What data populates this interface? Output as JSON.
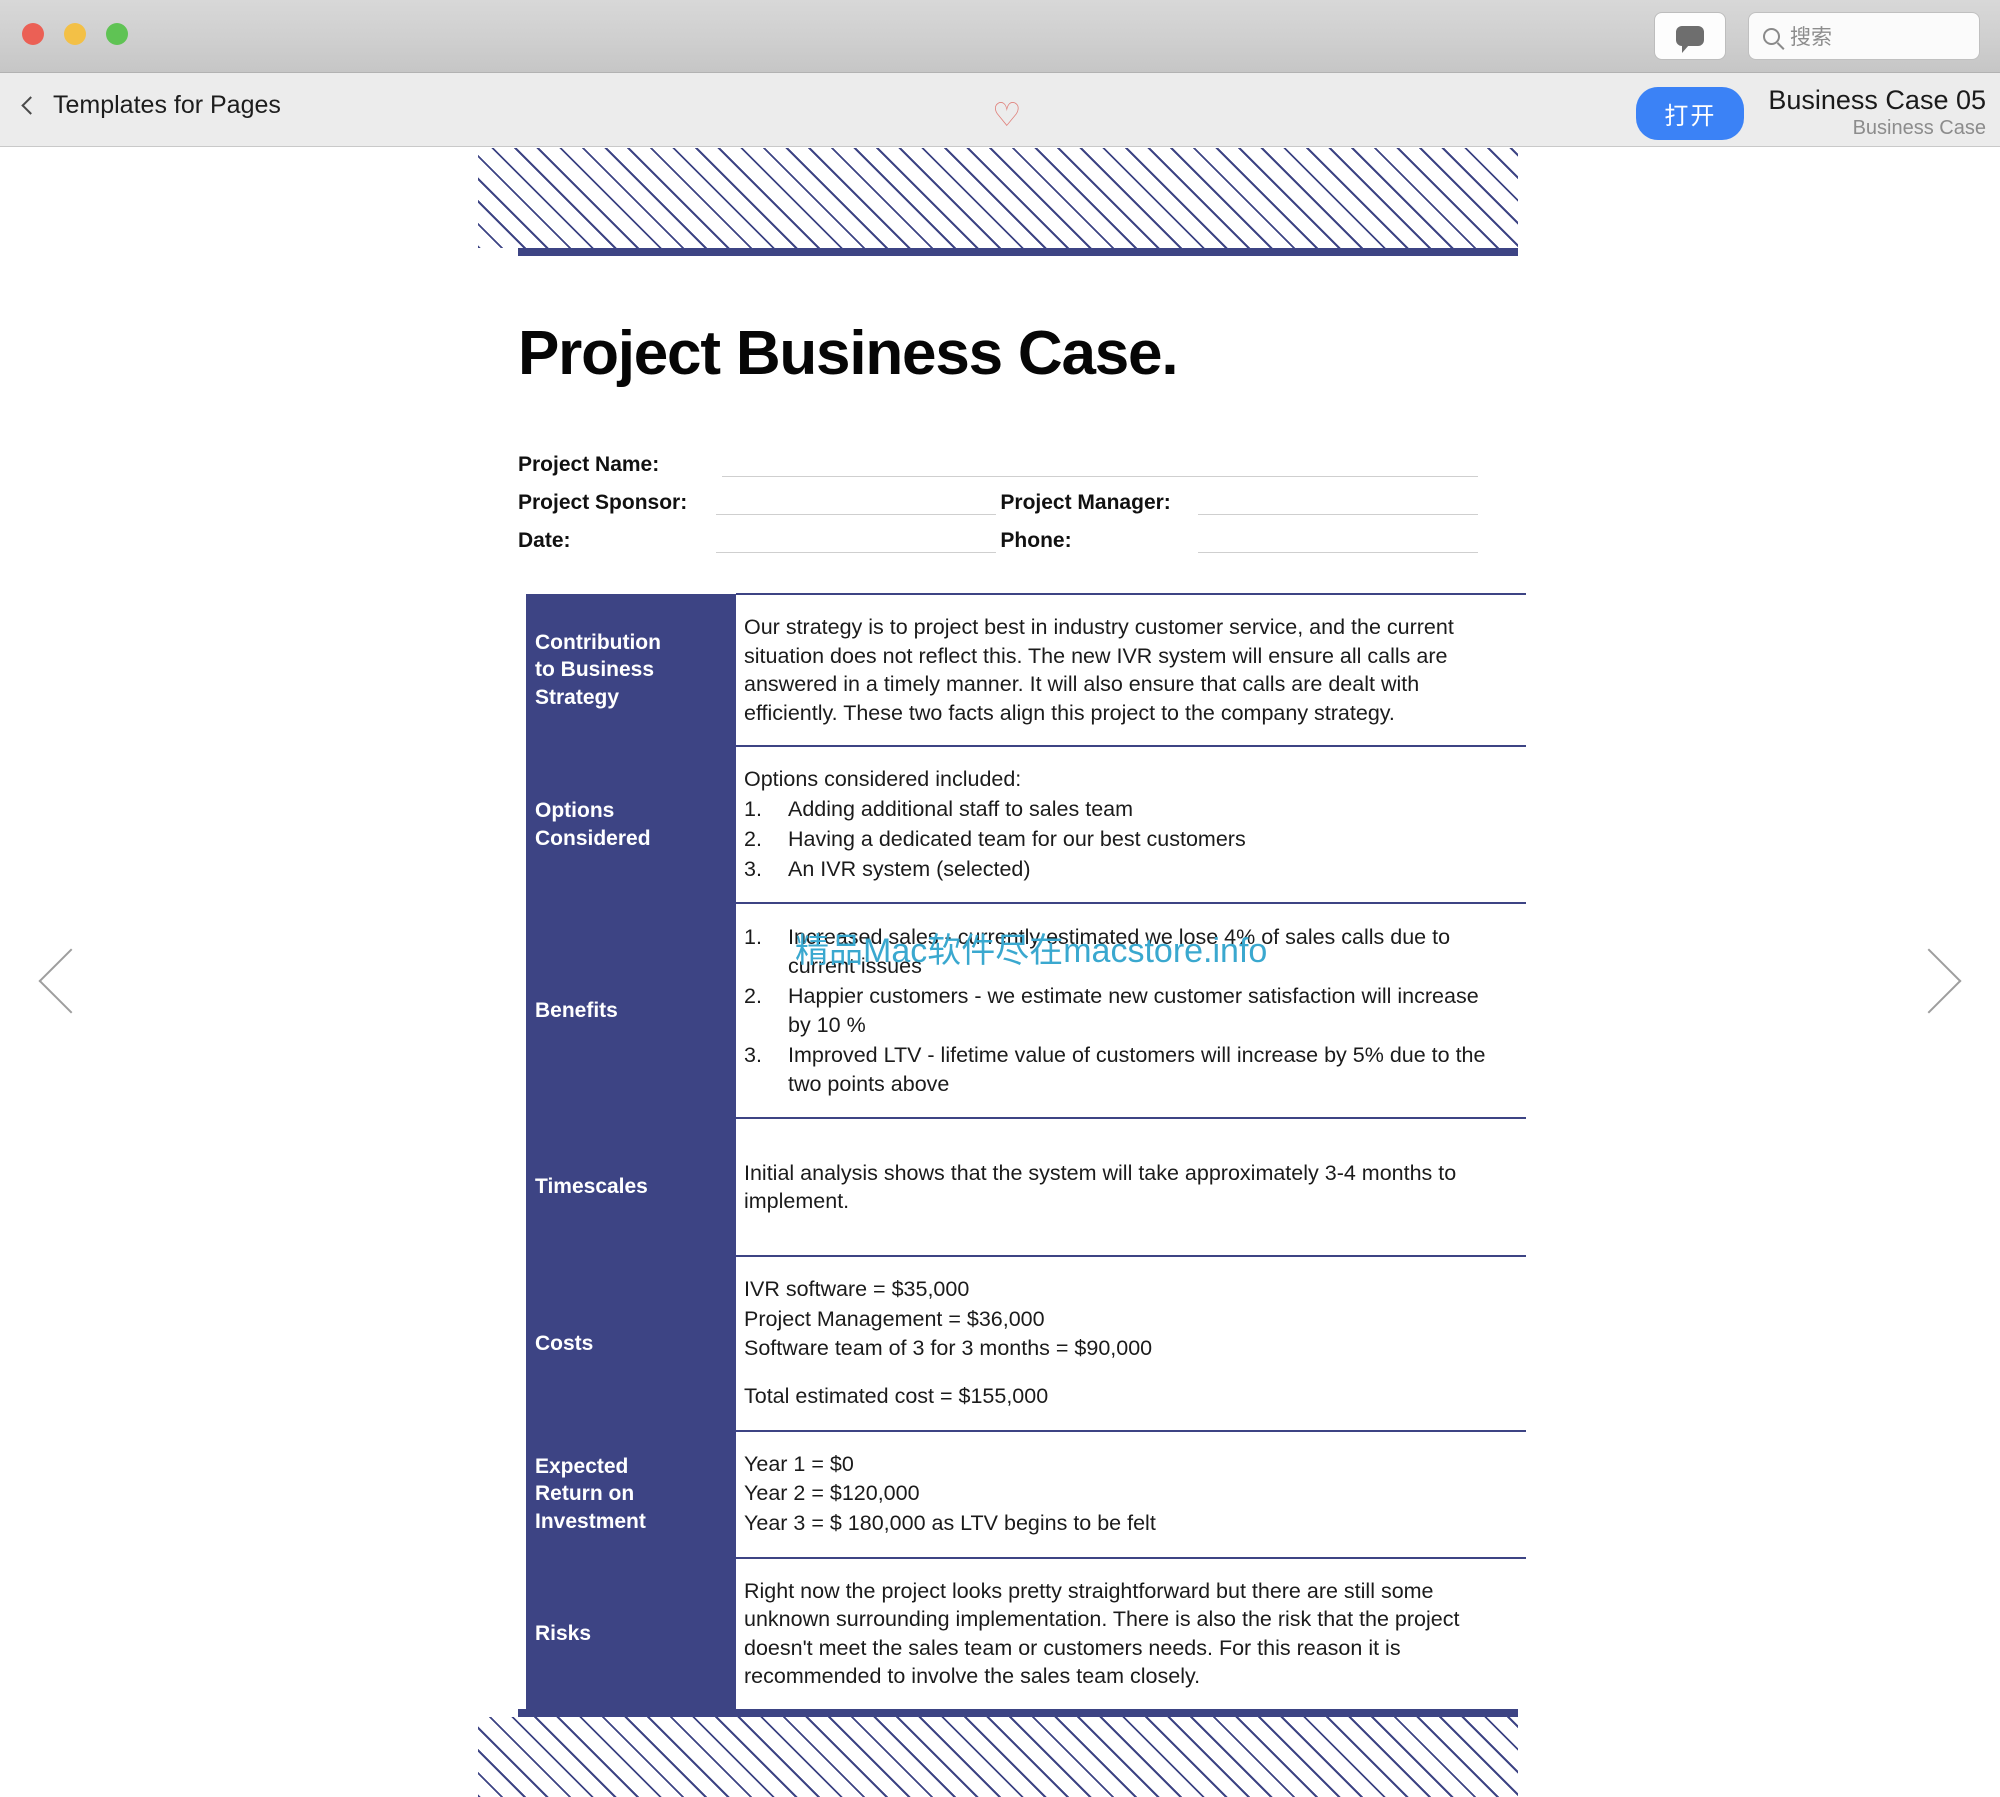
{
  "window": {
    "traffic_lights": [
      "close",
      "minimize",
      "zoom"
    ],
    "comment_icon": "comment-bubble-icon",
    "search": {
      "placeholder": "搜索",
      "value": "",
      "icon": "search-icon"
    }
  },
  "toolbar": {
    "back_label": "Templates for Pages",
    "back_icon": "chevron-left-icon",
    "favorite_icon": "heart-outline-icon",
    "open_button": "打开",
    "doc_title": "Business Case 05",
    "doc_subtitle": "Business Case"
  },
  "navigation": {
    "prev_icon": "chevron-left-icon",
    "next_icon": "chevron-right-icon"
  },
  "document": {
    "heading": "Project Business Case.",
    "form_fields": [
      {
        "label": "Project Name:",
        "value": ""
      },
      {
        "label": "Project Sponsor:",
        "value": ""
      },
      {
        "label": "Project Manager:",
        "value": ""
      },
      {
        "label": "Date:",
        "value": ""
      },
      {
        "label": "Phone:",
        "value": ""
      }
    ],
    "sections": [
      {
        "title": "Contribution\nto Business\nStrategy",
        "paragraph": "Our strategy is to project best in industry customer service, and the current situation does not reflect this. The new IVR system will ensure all calls are answered in a timely manner. It will also ensure that calls are dealt with efficiently. These two facts align this project to the company strategy."
      },
      {
        "title": "Options\nConsidered",
        "intro": "Options considered included:",
        "items": [
          "Adding additional staff to sales team",
          "Having a dedicated team for our best customers",
          "An IVR system (selected)"
        ]
      },
      {
        "title": "Benefits",
        "items": [
          "Increased sales - currently estimated we lose 4% of sales calls due to current issues",
          "Happier customers - we estimate new customer satisfaction will increase by 10 %",
          "Improved LTV - lifetime value of customers will increase by 5% due to the two points above"
        ]
      },
      {
        "title": "Timescales",
        "paragraph": "Initial analysis shows that the system will take approximately 3-4 months to implement."
      },
      {
        "title": "Costs",
        "lines": [
          "IVR software = $35,000",
          "Project Management = $36,000",
          "Software team of 3 for 3 months = $90,000"
        ],
        "total": "Total estimated cost = $155,000"
      },
      {
        "title": "Expected\nReturn on\nInvestment",
        "lines": [
          "Year 1 = $0",
          "Year 2 = $120,000",
          "Year 3 = $ 180,000 as LTV begins to be felt"
        ]
      },
      {
        "title": "Risks",
        "paragraph": "Right now the project looks pretty straightforward but there are still some unknown surrounding implementation. There is also the risk that the project doesn't meet the sales team or customers needs. For this reason it is recommended to involve the sales team closely."
      }
    ]
  },
  "watermark": {
    "text": "精品Mac软件尽在macstore.info",
    "color": "#3aa8cf"
  },
  "colors": {
    "accent_navy": "#3d4484",
    "open_button": "#3b82f6",
    "heart": "#e0827c"
  }
}
